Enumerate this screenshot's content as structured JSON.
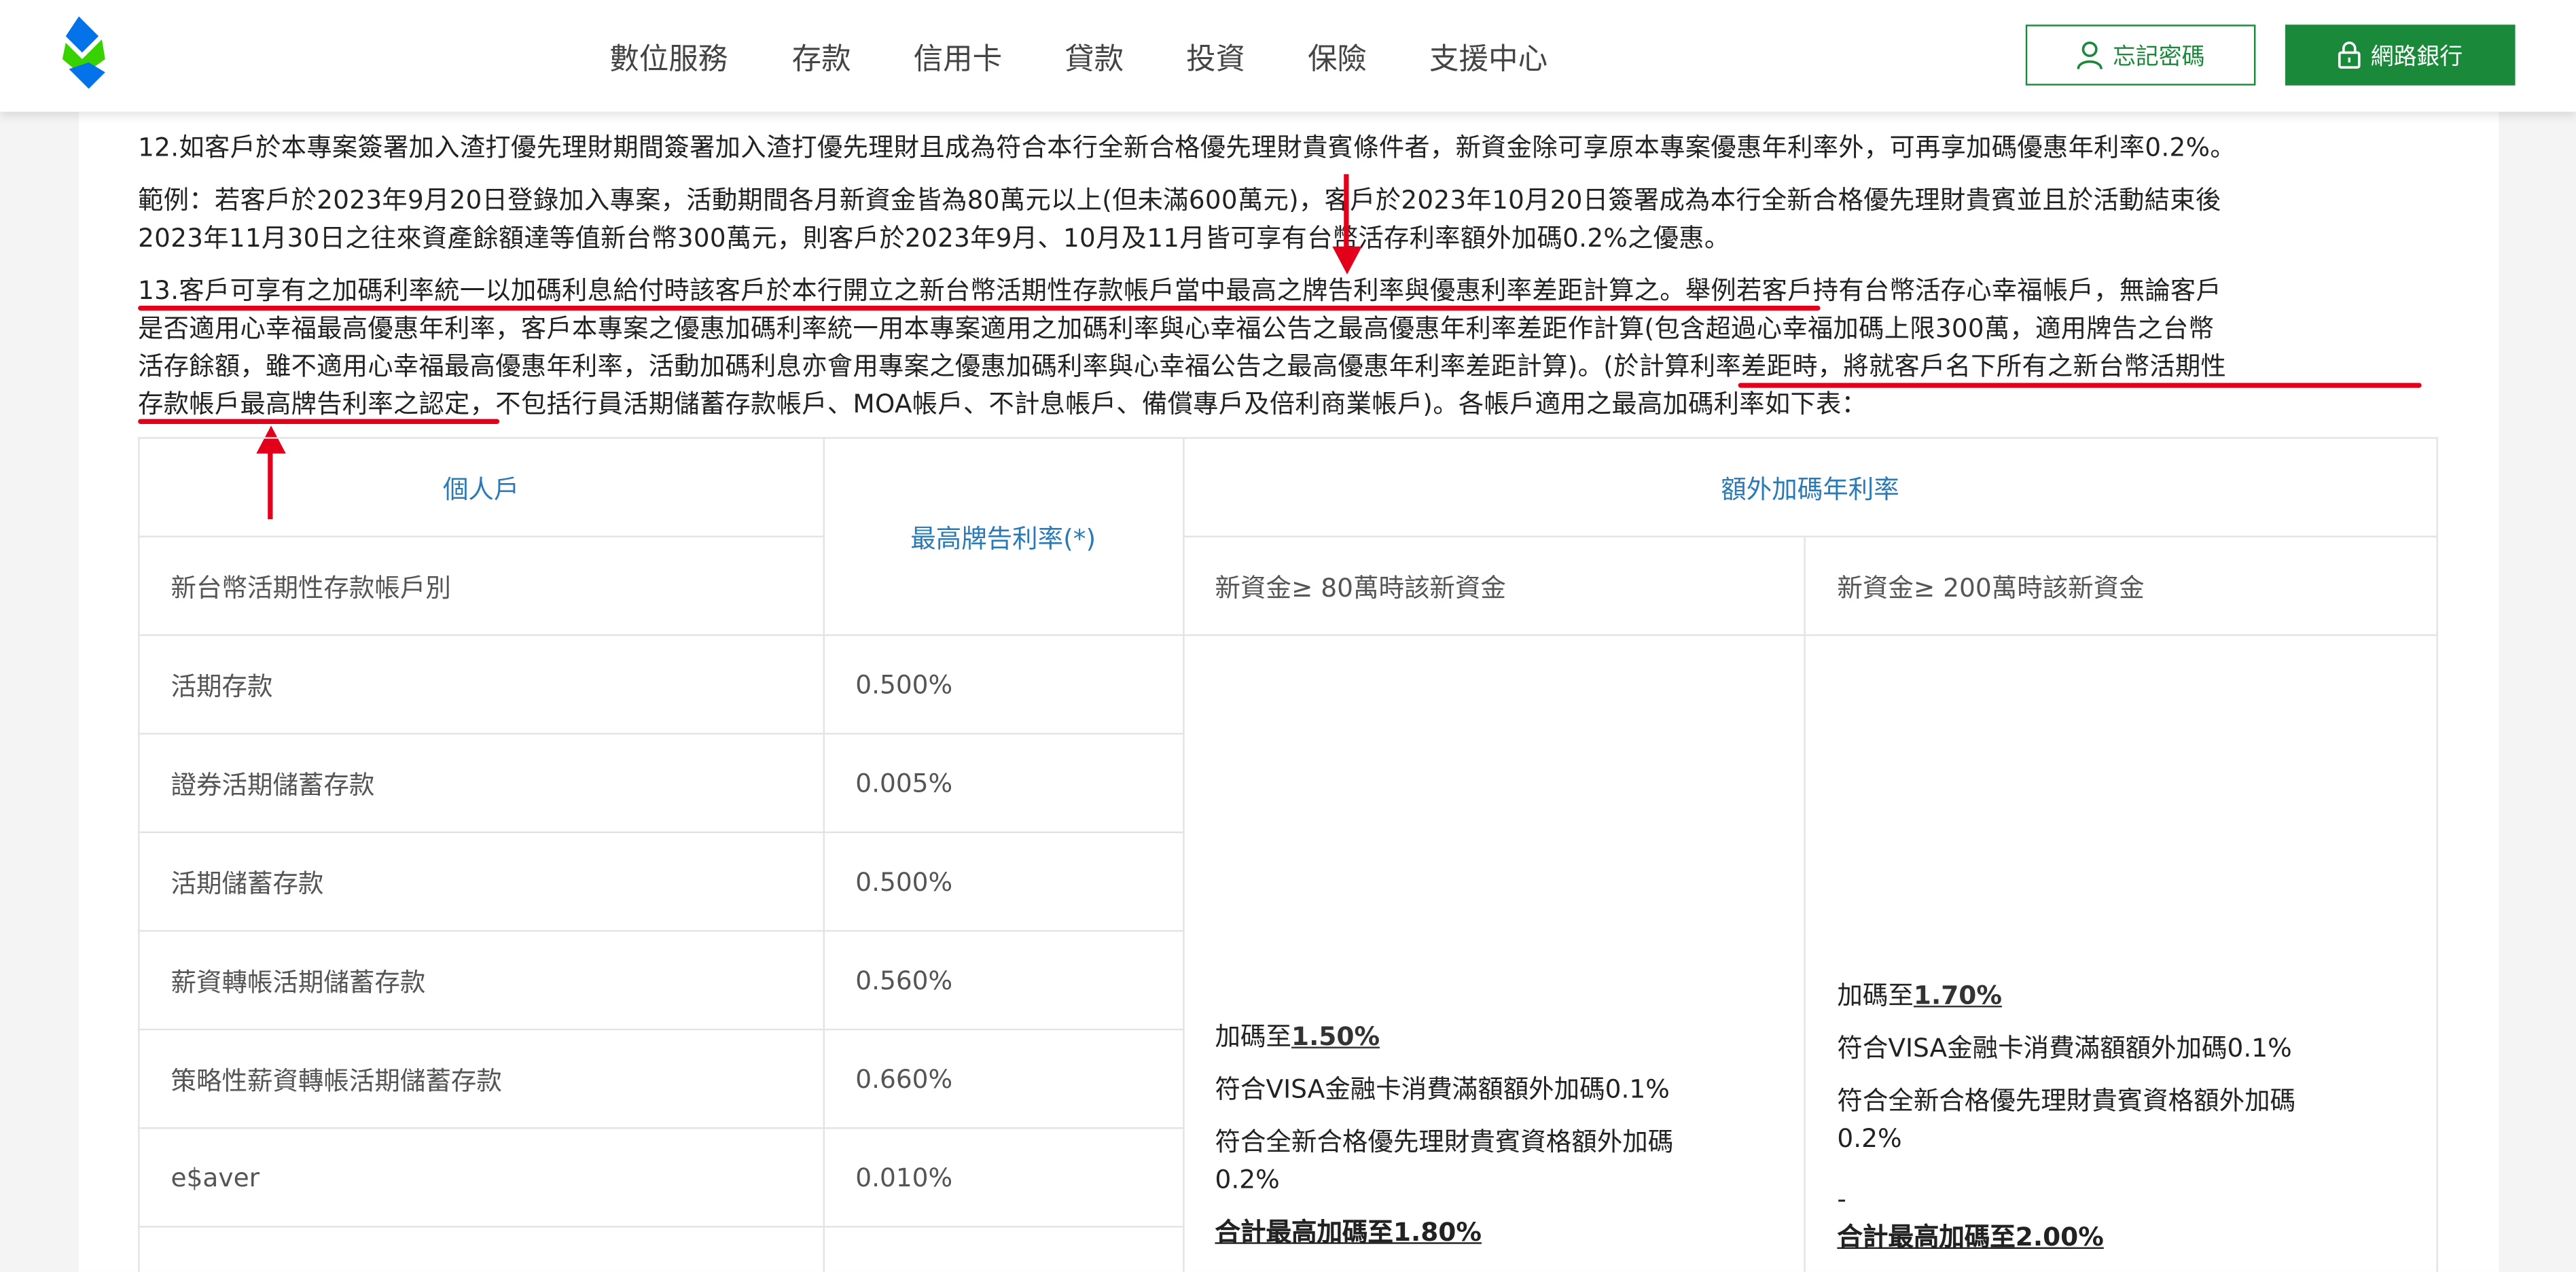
{
  "nav": {
    "items": [
      "數位服務",
      "存款",
      "信用卡",
      "貸款",
      "投資",
      "保險",
      "支援中心"
    ],
    "forgot_password": "忘記密碼",
    "online_banking": "網路銀行"
  },
  "paragraphs": {
    "p12": "12.如客戶於本專案簽署加入渣打優先理財期間簽署加入渣打優先理財且成為符合本行全新合格優先理財貴賓條件者，新資金除可享原本專案優惠年利率外，可再享加碼優惠年利率0.2%。",
    "ex_line1": "範例：若客戶於2023年9月20日登錄加入專案，活動期間各月新資金皆為80萬元以上(但未滿600萬元)，客戶於2023年10月20日簽署成為本行全新合格優先理財貴賓並且於活動結束後",
    "ex_line2": "2023年11月30日之往來資產餘額達等值新台幣300萬元，則客戶於2023年9月、10月及11月皆可享有台幣活存利率額外加碼0.2%之優惠。",
    "p13_line1": "13.客戶可享有之加碼利率統一以加碼利息給付時該客戶於本行開立之新台幣活期性存款帳戶當中最高之牌告利率與優惠利率差距計算之。舉例若客戶持有台幣活存心幸福帳戶，無論客戶",
    "p13_line2": "是否適用心幸福最高優惠年利率，客戶本專案之優惠加碼利率統一用本專案適用之加碼利率與心幸福公告之最高優惠年利率差距作計算(包含超過心幸福加碼上限300萬，適用牌告之台幣",
    "p13_line3": "活存餘額，雖不適用心幸福最高優惠年利率，活動加碼利息亦會用專案之優惠加碼利率與心幸福公告之最高優惠年利率差距計算)。(於計算利率差距時，將就客戶名下所有之新台幣活期性",
    "p13_line4": "存款帳戶最高牌告利率之認定，不包括行員活期儲蓄存款帳戶、MOA帳戶、不計息帳戶、備償專戶及倍利商業帳戶)。各帳戶適用之最高加碼利率如下表："
  },
  "table": {
    "header_personal": "個人戶",
    "header_max_rate": "最高牌告利率(*)",
    "header_extra": "額外加碼年利率",
    "header_account_type": "新台幣活期性存款帳戶別",
    "header_80": "新資金≥ 80萬時該新資金",
    "header_200": "新資金≥ 200萬時該新資金",
    "rows": [
      {
        "name": "活期存款",
        "rate": "0.500%"
      },
      {
        "name": "證券活期儲蓄存款",
        "rate": "0.005%"
      },
      {
        "name": "活期儲蓄存款",
        "rate": "0.500%"
      },
      {
        "name": "薪資轉帳活期儲蓄存款",
        "rate": "0.560%"
      },
      {
        "name": "策略性薪資轉帳活期儲蓄存款",
        "rate": "0.660%"
      },
      {
        "name": "e$aver",
        "rate": "0.010%"
      }
    ],
    "col80": {
      "prefix": "加碼至",
      "rate": "1.50%",
      "visa": "符合VISA金融卡消費滿額額外加碼0.1%",
      "priority_1": "符合全新合格優先理財貴賓資格額外加碼",
      "priority_2": "0.2%",
      "total": "合計最高加碼至1.80%"
    },
    "col200": {
      "prefix": "加碼至",
      "rate": "1.70%",
      "visa": "符合VISA金融卡消費滿額額外加碼0.1%",
      "priority_1": "符合全新合格優先理財貴賓資格額外加碼",
      "priority_2": "0.2%",
      "dash": "-",
      "total": "合計最高加碼至2.00%"
    }
  },
  "colors": {
    "brand_green": "#1a8a3a",
    "link_blue": "#2a7ab7",
    "annotation_red": "#e3001b"
  }
}
